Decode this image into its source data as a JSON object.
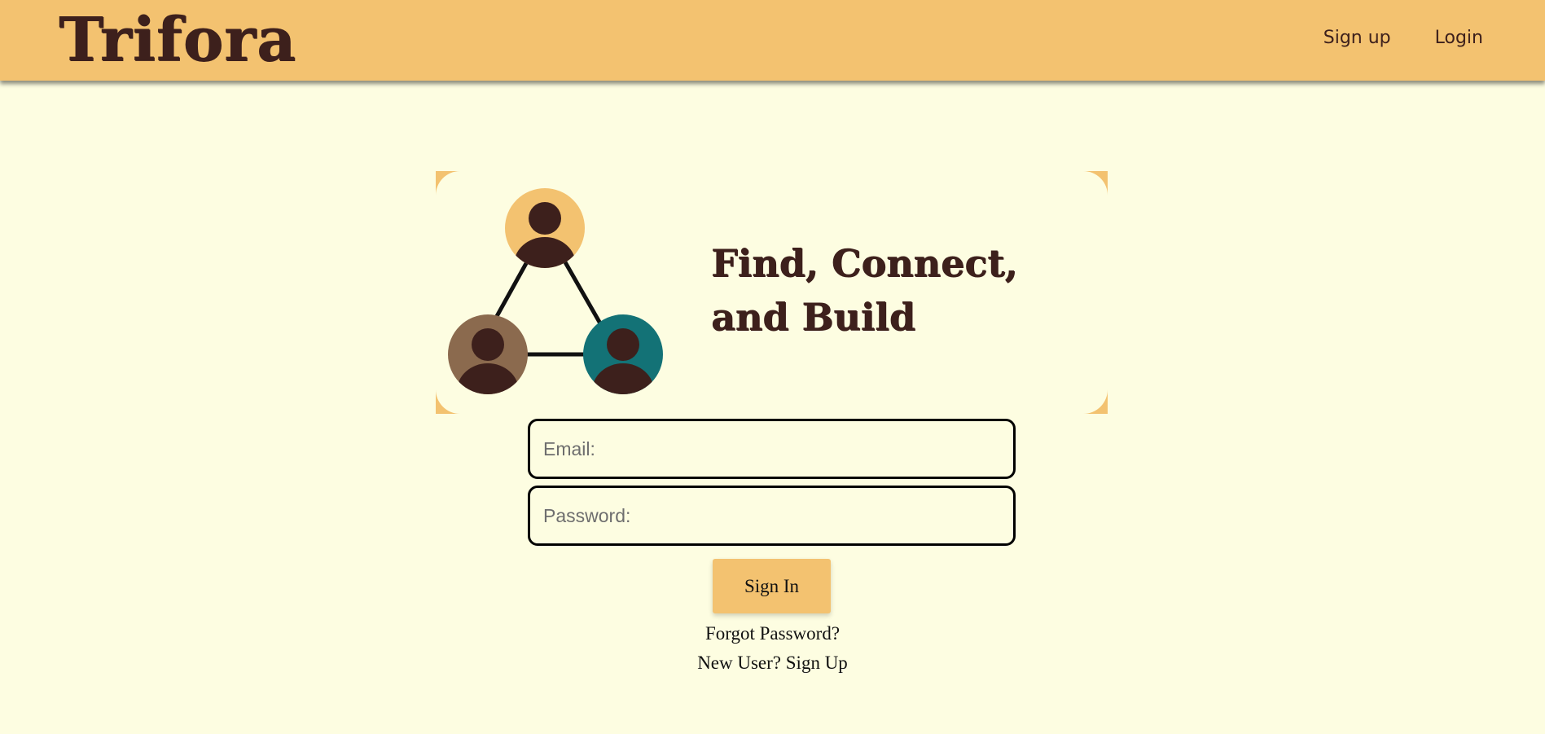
{
  "brand": {
    "title": "Trifora"
  },
  "nav": {
    "signup_label": "Sign up",
    "login_label": "Login"
  },
  "hero": {
    "title": "Find, Connect, and Build",
    "icons": [
      "user-avatar-icon",
      "user-avatar-icon",
      "user-avatar-icon"
    ],
    "avatar_colors": [
      "#f3c270",
      "#8b6a4e",
      "#137276"
    ]
  },
  "form": {
    "email_placeholder": "Email:",
    "password_placeholder": "Password:",
    "email_value": "",
    "password_value": "",
    "signin_label": "Sign In"
  },
  "links": {
    "forgot_password": "Forgot Password?",
    "new_user_prefix": "New User?",
    "new_user_signup": "Sign Up"
  },
  "colors": {
    "header": "#f3c270",
    "background": "#fdfde1",
    "brand_text": "#3d201c"
  }
}
